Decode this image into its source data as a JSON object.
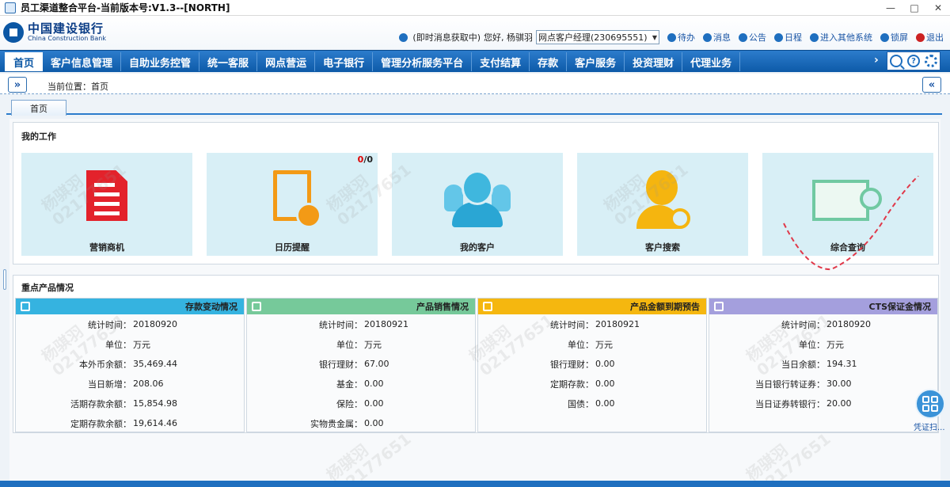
{
  "window": {
    "title": "员工渠道整合平台-当前版本号:V1.3--[NORTH]",
    "minimize": "—",
    "maximize": "□",
    "close": "✕"
  },
  "header": {
    "logo_cn": "中国建设银行",
    "logo_en": "China Construction Bank",
    "im_status": "(即时消息获取中)",
    "greeting": "您好, 杨骐羽",
    "role": "网点客户经理(230695551)",
    "links": [
      {
        "label": "待办",
        "icon": "todo-icon"
      },
      {
        "label": "消息",
        "icon": "message-icon"
      },
      {
        "label": "公告",
        "icon": "notice-icon"
      },
      {
        "label": "日程",
        "icon": "schedule-icon"
      },
      {
        "label": "进入其他系统",
        "icon": "system-icon"
      },
      {
        "label": "锁屏",
        "icon": "lock-icon"
      },
      {
        "label": "退出",
        "icon": "power-icon"
      }
    ]
  },
  "nav": {
    "items": [
      "首页",
      "客户信息管理",
      "自助业务控管",
      "统一客服",
      "网点营运",
      "电子银行",
      "管理分析服务平台",
      "支付结算",
      "存款",
      "客户服务",
      "投资理财",
      "代理业务"
    ],
    "more": "›",
    "help": "?"
  },
  "breadcrumb": {
    "text": "当前位置：首页",
    "expand_left": "»",
    "expand_right": "«"
  },
  "tabs": [
    "首页"
  ],
  "work": {
    "title": "我的工作",
    "tiles": [
      {
        "label": "营销商机",
        "icon": "document-icon"
      },
      {
        "label": "日历提醒",
        "icon": "calendar-reminder-icon",
        "badge_red": "0",
        "badge_sep": "/0"
      },
      {
        "label": "我的客户",
        "icon": "customers-icon"
      },
      {
        "label": "客户搜索",
        "icon": "customer-search-icon"
      },
      {
        "label": "综合查询",
        "icon": "general-query-icon"
      }
    ]
  },
  "products": {
    "title": "重点产品情况",
    "cards": [
      {
        "title": "存款变动情况",
        "color": "#35b3e0",
        "rows": [
          {
            "k": "统计时间：",
            "v": "20180920"
          },
          {
            "k": "单位：",
            "v": "万元"
          },
          {
            "k": "本外币余额：",
            "v": "35,469.44"
          },
          {
            "k": "当日新增：",
            "v": "208.06"
          },
          {
            "k": "活期存款余额：",
            "v": "15,854.98"
          },
          {
            "k": "定期存款余额：",
            "v": "19,614.46"
          }
        ]
      },
      {
        "title": "产品销售情况",
        "color": "#76c99a",
        "rows": [
          {
            "k": "统计时间：",
            "v": "20180921"
          },
          {
            "k": "单位：",
            "v": "万元"
          },
          {
            "k": "银行理财：",
            "v": "67.00"
          },
          {
            "k": "基金：",
            "v": "0.00"
          },
          {
            "k": "保险：",
            "v": "0.00"
          },
          {
            "k": "实物贵金属：",
            "v": "0.00"
          }
        ]
      },
      {
        "title": "产品金额到期预告",
        "color": "#f5b70f",
        "rows": [
          {
            "k": "统计时间：",
            "v": "20180921"
          },
          {
            "k": "单位：",
            "v": "万元"
          },
          {
            "k": "银行理财：",
            "v": "0.00"
          },
          {
            "k": "定期存款：",
            "v": "0.00"
          },
          {
            "k": "国债：",
            "v": "0.00"
          }
        ]
      },
      {
        "title": "CTS保证金情况",
        "color": "#a49fdd",
        "rows": [
          {
            "k": "统计时间：",
            "v": "20180920"
          },
          {
            "k": "单位：",
            "v": "万元"
          },
          {
            "k": "当日余额：",
            "v": "194.31"
          },
          {
            "k": "当日银行转证券：",
            "v": "30.00"
          },
          {
            "k": "当日证券转银行：",
            "v": "20.00"
          }
        ]
      }
    ]
  },
  "float": {
    "label": "凭证扫..."
  },
  "watermark": {
    "name": "杨骐羽",
    "id": "02177651"
  }
}
